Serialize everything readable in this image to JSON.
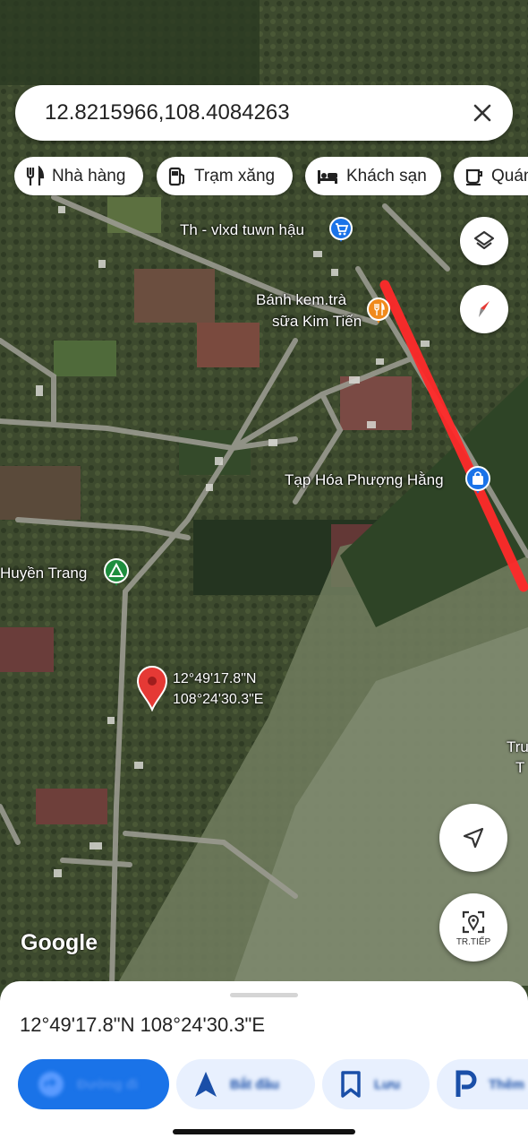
{
  "search": {
    "query": "12.8215966,108.4084263"
  },
  "chips": [
    {
      "label": "Nhà hàng",
      "icon": "fork-knife-icon"
    },
    {
      "label": "Trạm xăng",
      "icon": "gas-station-icon"
    },
    {
      "label": "Khách sạn",
      "icon": "bed-icon"
    },
    {
      "label": "Quán",
      "icon": "coffee-cup-icon"
    }
  ],
  "places": {
    "store1": "Th - vlxd tuwn hậu",
    "cafe_line1": "Bánh kem.trà",
    "cafe_line2": "sữa Kim Tiến",
    "grocery": "Tạp Hóa Phượng Hằng",
    "camp": "Huyền Trang",
    "edge_line1": "Tru",
    "edge_line2": "T"
  },
  "pin": {
    "lat": "12°49'17.8\"N",
    "lng": "108°24'30.3\"E"
  },
  "map_controls": {
    "next_label": "TR.TIẾP"
  },
  "brand": "Google",
  "sheet": {
    "coordinates": "12°49'17.8\"N 108°24'30.3\"E",
    "actions": [
      {
        "label": "Đường đi",
        "icon": "directions-icon"
      },
      {
        "label": "Bắt đầu",
        "icon": "navigate-arrow-icon"
      },
      {
        "label": "Lưu",
        "icon": "bookmark-icon"
      },
      {
        "label": "Thêm",
        "icon": "parking-icon"
      }
    ]
  },
  "colors": {
    "accent": "#1a73e8",
    "route_line": "#ff2a2a",
    "pin": "#e53935"
  }
}
